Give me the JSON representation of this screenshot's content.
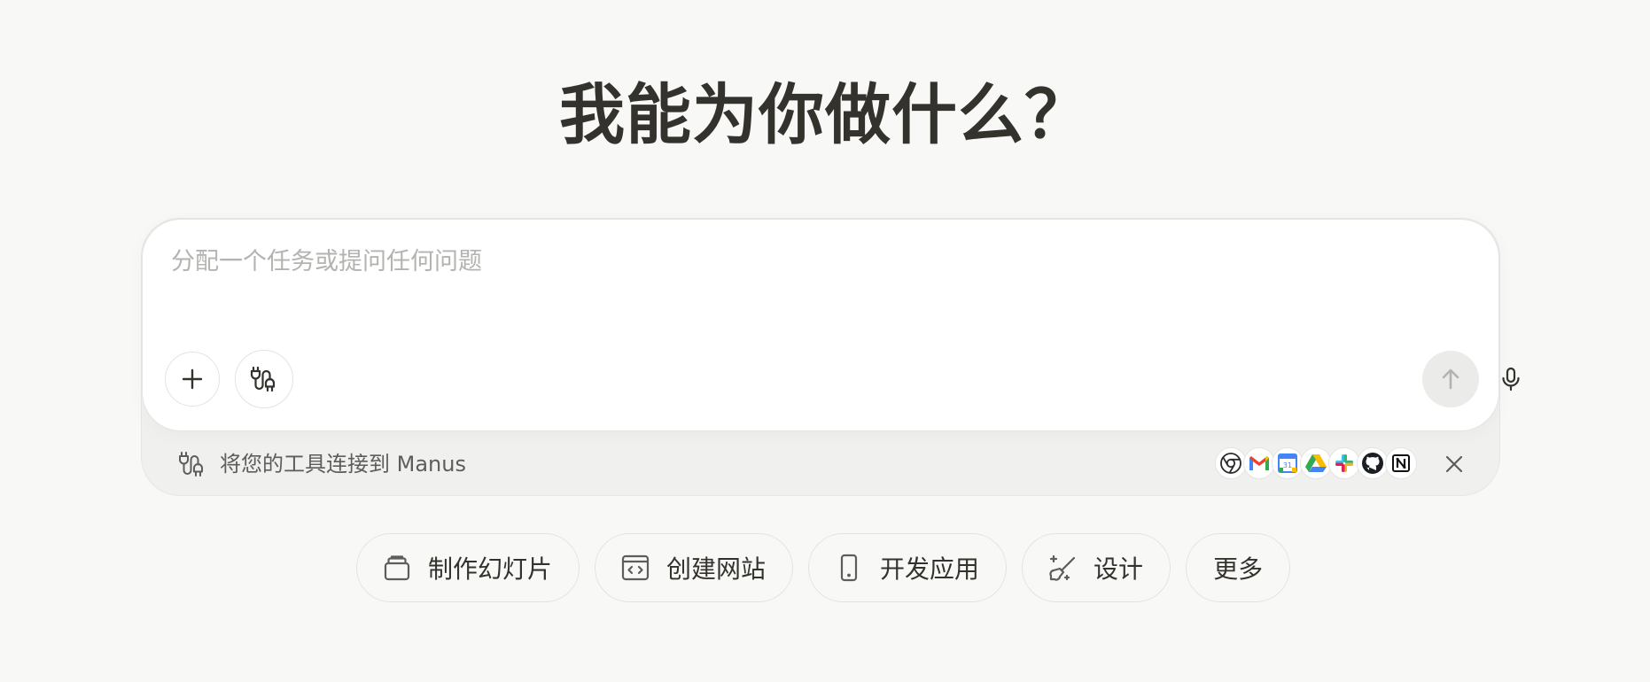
{
  "headline": "我能为你做什么？",
  "composer": {
    "placeholder": "分配一个任务或提问任何问题",
    "value": ""
  },
  "buttons": {
    "add": "plus-icon",
    "connect": "plug-icon",
    "mic": "microphone-icon",
    "send": "arrow-up-icon"
  },
  "tools_bar": {
    "text": "将您的工具连接到 Manus",
    "apps": [
      "chrome-icon",
      "gmail-icon",
      "google-calendar-icon",
      "google-drive-icon",
      "slack-icon",
      "github-icon",
      "notion-icon"
    ],
    "calendar_day": "31"
  },
  "chips": [
    {
      "label": "制作幻灯片",
      "icon": "slides-icon"
    },
    {
      "label": "创建网站",
      "icon": "website-icon"
    },
    {
      "label": "开发应用",
      "icon": "mobile-app-icon"
    },
    {
      "label": "设计",
      "icon": "design-brush-icon"
    },
    {
      "label": "更多",
      "icon": ""
    }
  ],
  "colors": {
    "background": "#f8f8f7",
    "text": "#34322d",
    "placeholder": "#b4b3b0",
    "send_disabled": "#ebebea"
  }
}
